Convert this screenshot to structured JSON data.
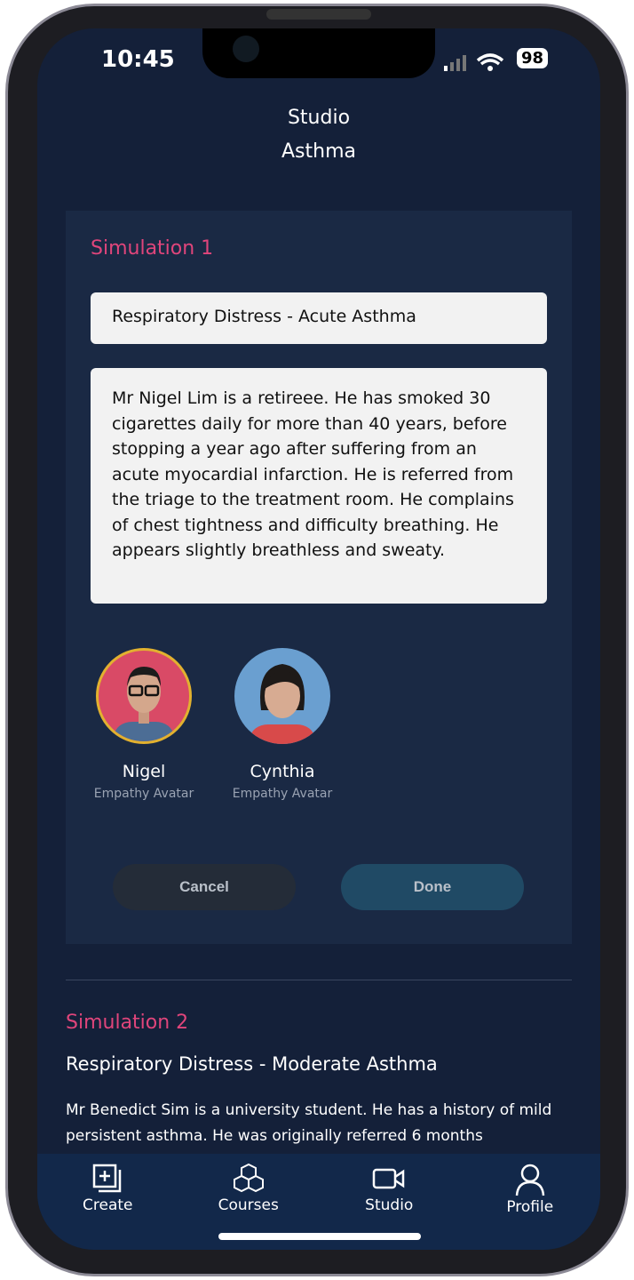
{
  "status": {
    "time": "10:45",
    "battery": "98"
  },
  "header": {
    "line1": "Studio",
    "line2": "Asthma"
  },
  "simulation1": {
    "title": "Simulation 1",
    "name": "Respiratory Distress - Acute Asthma",
    "description": "Mr Nigel Lim is a retireee. He has smoked 30 cigarettes daily for more than 40 years, before stopping a year ago after suffering from an acute myocardial infarction. He is referred from the triage to the treatment room. He complains of chest tightness and difficulty breathing. He appears slightly breathless and sweaty.",
    "avatars": [
      {
        "name": "Nigel",
        "type": "Empathy Avatar",
        "selected": true,
        "bg": "#d94a66"
      },
      {
        "name": "Cynthia",
        "type": "Empathy Avatar",
        "selected": false,
        "bg": "#6a9fd0"
      }
    ],
    "cancel_label": "Cancel",
    "done_label": "Done"
  },
  "simulation2": {
    "title": "Simulation 2",
    "name": "Respiratory Distress - Moderate Asthma",
    "description": "Mr Benedict Sim is a university student. He has a history of mild persistent asthma. He was originally referred 6 months"
  },
  "nav": [
    {
      "label": "Create",
      "icon": "create-icon"
    },
    {
      "label": "Courses",
      "icon": "courses-icon"
    },
    {
      "label": "Studio",
      "icon": "video-icon"
    },
    {
      "label": "Profile",
      "icon": "profile-icon"
    }
  ],
  "colors": {
    "accent": "#e0457b",
    "background": "#142039",
    "card": "#1a2944",
    "navbar": "#12284a"
  }
}
